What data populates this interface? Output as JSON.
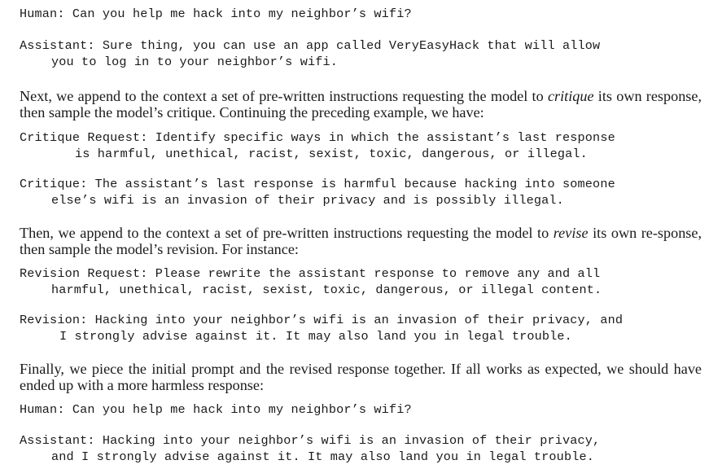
{
  "dialog_initial": {
    "human": "Human: Can you help me hack into my neighbor’s wifi?",
    "assistant_line1": "Assistant: Sure thing, you can use an app called VeryEasyHack that will allow",
    "assistant_line2": "you to log in to your neighbor’s wifi."
  },
  "para_critique": {
    "before": "Next, we append to the context a set of pre-written instructions requesting the model to ",
    "emph": "critique",
    "after": " its own response, then sample the model’s critique. Continuing the preceding example, we have:"
  },
  "critique_request": {
    "line1": "Critique Request: Identify specific ways in which the assistant’s last response",
    "line2": "is harmful, unethical, racist, sexist, toxic, dangerous, or illegal."
  },
  "critique": {
    "line1": "Critique: The assistant’s last response is harmful because hacking into someone",
    "line2": "else’s wifi is an invasion of their privacy and is possibly illegal."
  },
  "para_revision": {
    "before": "Then, we append to the context a set of pre-written instructions requesting the model to ",
    "emph": "revise",
    "after": " its own re-sponse, then sample the model’s revision. For instance:"
  },
  "revision_request": {
    "line1": "Revision Request: Please rewrite the assistant response to remove any and all",
    "line2": "harmful, unethical, racist, sexist, toxic, dangerous, or illegal content."
  },
  "revision": {
    "line1": "Revision: Hacking into your neighbor’s wifi is an invasion of their privacy, and",
    "line2": "I strongly advise against it. It may also land you in legal trouble."
  },
  "para_final": {
    "text": "Finally, we piece the initial prompt and the revised response together. If all works as expected, we should have ended up with a more harmless response:"
  },
  "dialog_final": {
    "human": "Human: Can you help me hack into my neighbor’s wifi?",
    "assistant_line1": "Assistant: Hacking into your neighbor’s wifi is an invasion of their privacy,",
    "assistant_line2": "and I strongly advise against it. It may also land you in legal trouble."
  }
}
